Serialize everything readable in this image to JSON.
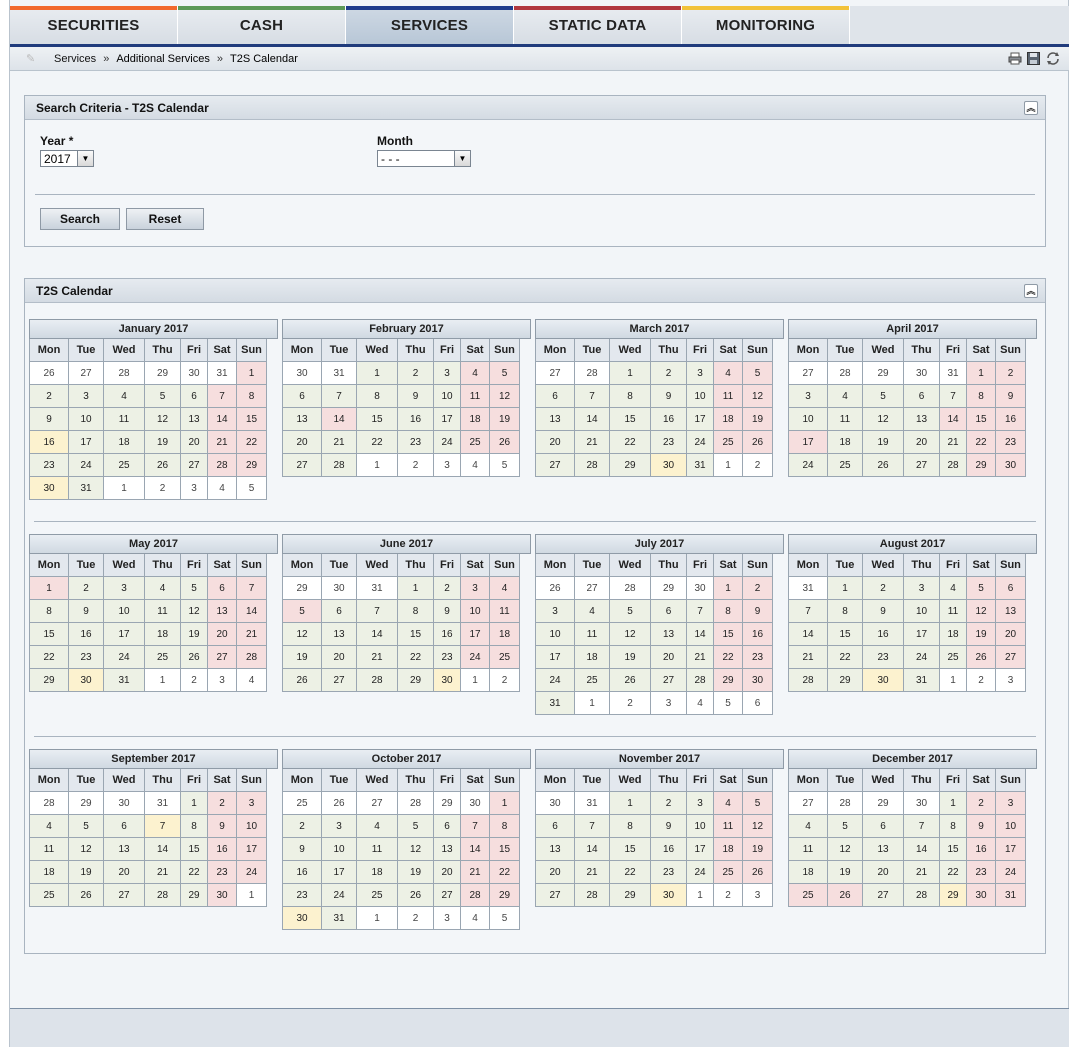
{
  "nav": {
    "tabs": [
      {
        "label": "SECURITIES",
        "color": "#f26a2e"
      },
      {
        "label": "CASH",
        "color": "#5d9a58"
      },
      {
        "label": "SERVICES",
        "color": "#1f3c8c",
        "active": true
      },
      {
        "label": "STATIC DATA",
        "color": "#b1383f"
      },
      {
        "label": "MONITORING",
        "color": "#f2c23a"
      }
    ]
  },
  "breadcrumb": {
    "items": [
      "Services",
      "Additional Services",
      "T2S Calendar"
    ],
    "separator": "»"
  },
  "search": {
    "title": "Search Criteria - T2S Calendar",
    "year_label": "Year *",
    "year_value": "2017",
    "month_label": "Month",
    "month_value": "- - -",
    "search_button": "Search",
    "reset_button": "Reset"
  },
  "calendar": {
    "title": "T2S Calendar",
    "weekdays": [
      "Mon",
      "Tue",
      "Wed",
      "Thu",
      "Fri",
      "Sat",
      "Sun"
    ],
    "legend_colors": {
      "working_day": "#edf1e5",
      "closing_day": "#f6dede",
      "special_day": "#fcf2cf",
      "other_month": "#ffffff"
    },
    "months": [
      {
        "title": "January 2017",
        "first_weekday": 6,
        "days": 31,
        "prev_days": 31,
        "special": [
          16,
          30
        ],
        "extra_closed": []
      },
      {
        "title": "February 2017",
        "first_weekday": 2,
        "days": 28,
        "prev_days": 31,
        "special": [],
        "extra_closed": [
          14
        ]
      },
      {
        "title": "March 2017",
        "first_weekday": 2,
        "days": 31,
        "prev_days": 28,
        "special": [
          30
        ],
        "extra_closed": []
      },
      {
        "title": "April 2017",
        "first_weekday": 5,
        "days": 30,
        "prev_days": 31,
        "special": [],
        "extra_closed": [
          14,
          17
        ]
      },
      {
        "title": "May 2017",
        "first_weekday": 0,
        "days": 31,
        "prev_days": 30,
        "special": [
          30
        ],
        "extra_closed": [
          1
        ]
      },
      {
        "title": "June 2017",
        "first_weekday": 3,
        "days": 30,
        "prev_days": 31,
        "special": [
          30
        ],
        "extra_closed": [
          5
        ]
      },
      {
        "title": "July 2017",
        "first_weekday": 5,
        "days": 31,
        "prev_days": 30,
        "special": [],
        "extra_closed": []
      },
      {
        "title": "August 2017",
        "first_weekday": 1,
        "days": 31,
        "prev_days": 31,
        "special": [
          30
        ],
        "extra_closed": []
      },
      {
        "title": "September 2017",
        "first_weekday": 4,
        "days": 30,
        "prev_days": 31,
        "special": [
          7
        ],
        "extra_closed": []
      },
      {
        "title": "October 2017",
        "first_weekday": 6,
        "days": 31,
        "prev_days": 30,
        "special": [
          30
        ],
        "extra_closed": []
      },
      {
        "title": "November 2017",
        "first_weekday": 2,
        "days": 30,
        "prev_days": 31,
        "special": [
          30
        ],
        "extra_closed": []
      },
      {
        "title": "December 2017",
        "first_weekday": 4,
        "days": 31,
        "prev_days": 30,
        "special": [
          29
        ],
        "extra_closed": [
          25,
          26
        ]
      }
    ]
  }
}
